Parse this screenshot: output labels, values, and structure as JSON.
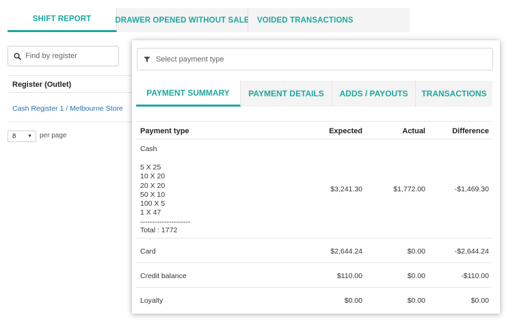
{
  "top_tabs": [
    {
      "label": "SHIFT REPORT"
    },
    {
      "label": "DRAWER OPENED WITHOUT SALE"
    },
    {
      "label": "VOIDED TRANSACTIONS"
    }
  ],
  "left": {
    "search_placeholder": "Find by register",
    "column_header": "Register (Outlet)",
    "register_link": "Cash Register 1 / Melbourne Store",
    "per_page_value": "8",
    "per_page_label": "per page"
  },
  "card": {
    "filter_placeholder": "Select payment type",
    "tabs": [
      {
        "label": "PAYMENT SUMMARY"
      },
      {
        "label": "PAYMENT DETAILS"
      },
      {
        "label": "ADDS / PAYOUTS"
      },
      {
        "label": "TRANSACTIONS"
      }
    ],
    "table": {
      "headers": {
        "type": "Payment type",
        "expected": "Expected",
        "actual": "Actual",
        "difference": "Difference"
      },
      "cash": {
        "type": "Cash",
        "denominations": [
          "5 X 25",
          "10 X 20",
          "20 X 20",
          "50 X 10",
          "100 X 5",
          "1 X 47",
          "---------------------"
        ],
        "total": "Total : 1772",
        "expected": "$3,241.30",
        "actual": "$1,772.00",
        "difference": "-$1,469.30"
      },
      "rows": [
        {
          "type": "Card",
          "expected": "$2,644.24",
          "actual": "$0.00",
          "difference": "-$2,644.24"
        },
        {
          "type": "Credit balance",
          "expected": "$110.00",
          "actual": "$0.00",
          "difference": "-$110.00"
        },
        {
          "type": "Loyalty",
          "expected": "$0.00",
          "actual": "$0.00",
          "difference": "$0.00"
        }
      ]
    }
  },
  "colors": {
    "accent": "#1ea7a0",
    "link": "#2a6fb0"
  }
}
